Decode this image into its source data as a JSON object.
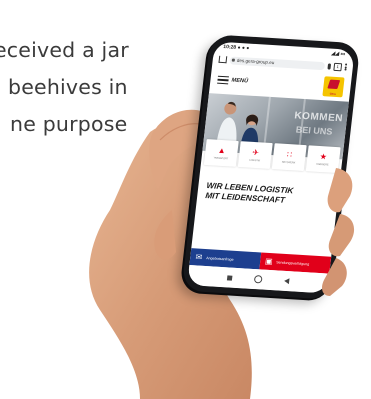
{
  "background_text": {
    "lines": [
      "eceived a jar",
      "beehives in",
      "ne purpose"
    ]
  },
  "phone": {
    "status_bar": {
      "time": "10:28 ● ● ●",
      "indicators": "◢◢ ▭"
    },
    "browser": {
      "url": "des.gera-group.eu",
      "tab_count": "1"
    },
    "site": {
      "menu_label": "MENÜ",
      "logo_text": "Gera",
      "hero_text_1": "KOMMEN",
      "hero_text_2": "BEI UNS",
      "tiles": [
        {
          "icon": "road-icon",
          "glyph": "▲",
          "label": "TRANSPORT"
        },
        {
          "icon": "logistics-icon",
          "glyph": "✈",
          "label": "LOGISTIK"
        },
        {
          "icon": "network-icon",
          "glyph": "∷",
          "label": "NETZWERK"
        },
        {
          "icon": "star-icon",
          "glyph": "★",
          "label": "KARRIERE"
        }
      ],
      "slogan_line_1": "WIR LEBEN LOGISTIK",
      "slogan_line_2": "MIT LEIDENSCHAFT",
      "cta_inquiry": "Angebotsanfrage",
      "cta_tracking": "Sendungsverfolgung"
    },
    "colors": {
      "brand_red": "#e1001a",
      "brand_blue": "#1d3f8f",
      "brand_yellow": "#f5c400"
    }
  }
}
